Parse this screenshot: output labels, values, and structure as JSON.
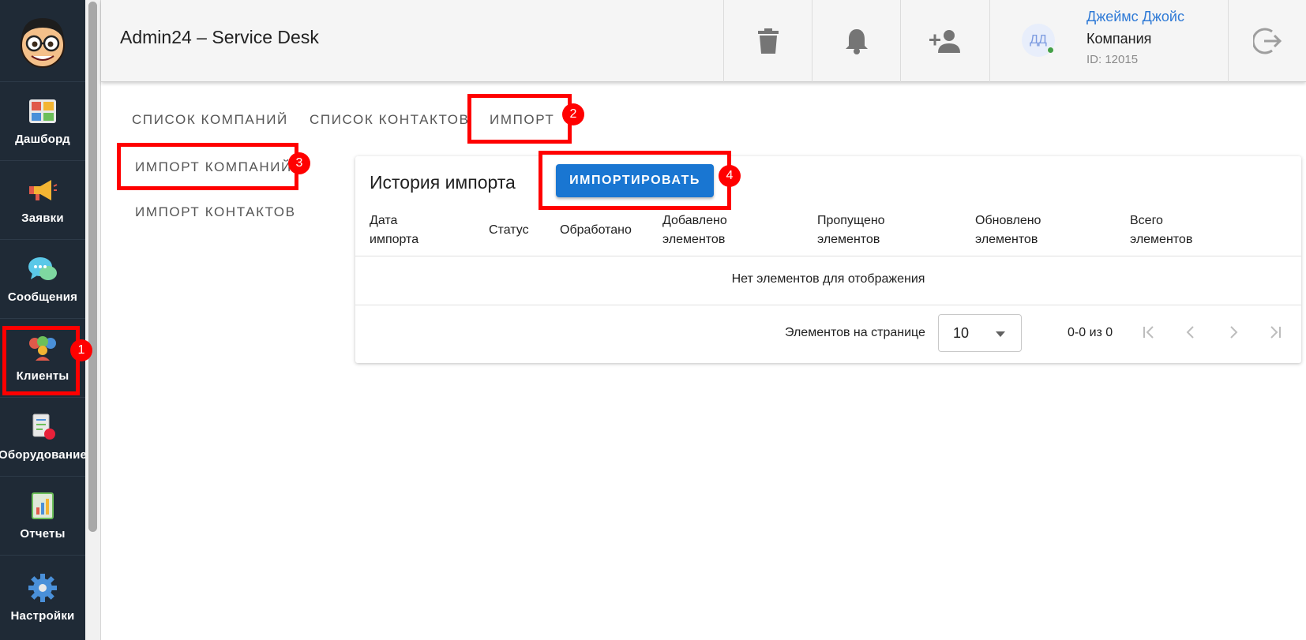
{
  "app": {
    "title": "Admin24 – Service Desk"
  },
  "sidebar": {
    "items": [
      {
        "label": "Дашборд",
        "icon": "dashboard-icon"
      },
      {
        "label": "Заявки",
        "icon": "megaphone-icon"
      },
      {
        "label": "Сообщения",
        "icon": "chat-bubbles-icon"
      },
      {
        "label": "Клиенты",
        "icon": "clients-icon"
      },
      {
        "label": "Оборудование",
        "icon": "equipment-icon"
      },
      {
        "label": "Отчеты",
        "icon": "reports-icon"
      },
      {
        "label": "Настройки",
        "icon": "gear-icon"
      }
    ]
  },
  "header": {
    "user": {
      "initials": "ДД",
      "name": "Джеймс Джойс",
      "company": "Компания",
      "id": "ID: 12015"
    }
  },
  "tabs": [
    {
      "label": "СПИСОК КОМПАНИЙ"
    },
    {
      "label": "СПИСОК КОНТАКТОВ"
    },
    {
      "label": "ИМПОРТ"
    }
  ],
  "subnav": [
    {
      "label": "ИМПОРТ КОМПАНИЙ"
    },
    {
      "label": "ИМПОРТ КОНТАКТОВ"
    }
  ],
  "card": {
    "title": "История импорта",
    "import_button": "ИМПОРТИРОВАТЬ",
    "columns": [
      {
        "line1": "Дата",
        "line2": "импорта"
      },
      {
        "line1": "Статус",
        "line2": ""
      },
      {
        "line1": "Обработано",
        "line2": ""
      },
      {
        "line1": "Добавлено",
        "line2": "элементов"
      },
      {
        "line1": "Пропущено",
        "line2": "элементов"
      },
      {
        "line1": "Обновлено",
        "line2": "элементов"
      },
      {
        "line1": "Всего",
        "line2": "элементов"
      }
    ],
    "empty_message": "Нет элементов для отображения",
    "pagination": {
      "items_per_page_label": "Элементов на странице",
      "items_per_page": "10",
      "range": "0-0 из 0"
    }
  },
  "annotations": [
    "1",
    "2",
    "3",
    "4"
  ],
  "colors": {
    "sidebar_bg": "#1f2a36",
    "primary": "#1976d2",
    "highlight": "#ff0000",
    "link": "#2f7ad6"
  }
}
